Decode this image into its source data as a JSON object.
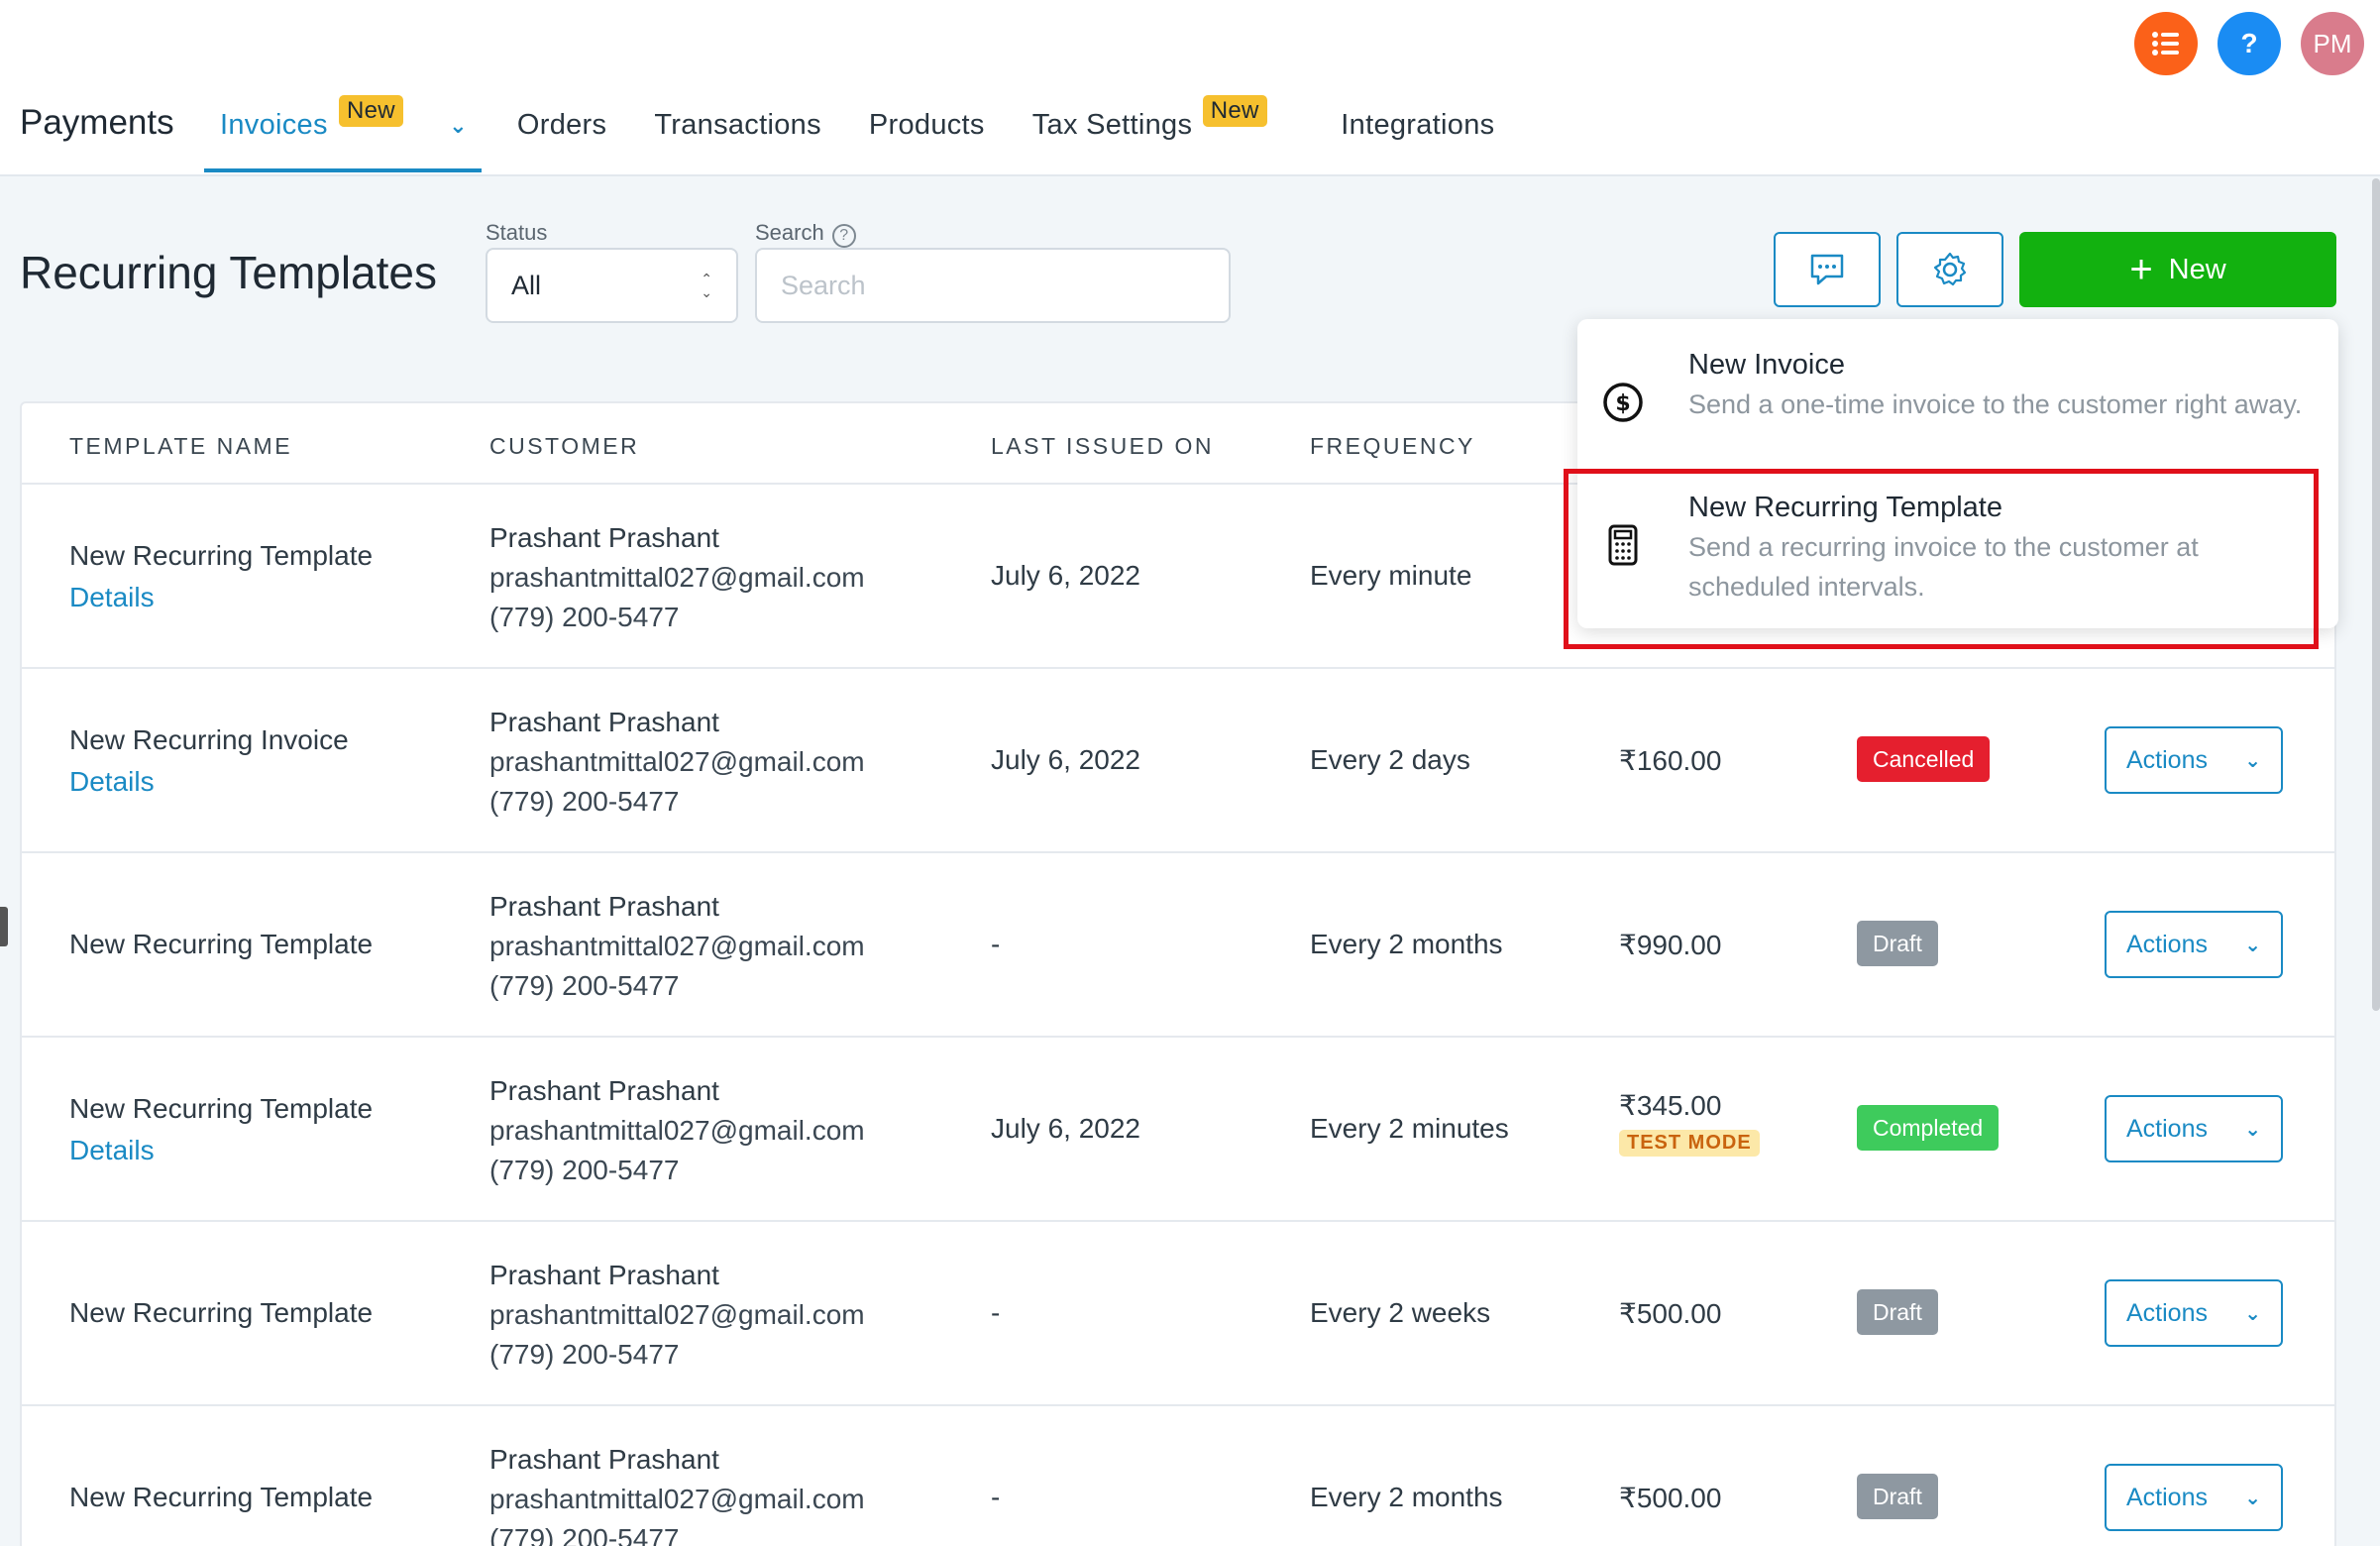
{
  "header": {
    "app_title": "Payments",
    "tabs": [
      {
        "label": "Invoices",
        "badge": "New",
        "active": true
      },
      {
        "label": "Orders"
      },
      {
        "label": "Transactions"
      },
      {
        "label": "Products"
      },
      {
        "label": "Tax Settings",
        "badge": "New"
      },
      {
        "label": "Integrations"
      }
    ],
    "icons": {
      "tasks": "list-icon",
      "help": "?",
      "avatar_initials": "PM"
    }
  },
  "page": {
    "title": "Recurring Templates",
    "status_label": "Status",
    "status_value": "All",
    "search_label": "Search",
    "search_placeholder": "Search",
    "new_button_label": "New"
  },
  "dropdown": {
    "items": [
      {
        "title": "New Invoice",
        "description": "Send a one-time invoice to the customer right away."
      },
      {
        "title": "New Recurring Template",
        "description": "Send a recurring invoice to the customer at scheduled intervals."
      }
    ]
  },
  "table": {
    "columns": [
      "TEMPLATE NAME",
      "CUSTOMER",
      "LAST ISSUED ON",
      "FREQUENCY"
    ],
    "rows": [
      {
        "name": "New Recurring Template",
        "details": "Details",
        "customer": "Prashant Prashant",
        "email": "prashantmittal027@gmail.com",
        "phone": "(779) 200-5477",
        "last_issued": "July 6, 2022",
        "frequency": "Every minute"
      },
      {
        "name": "New Recurring Invoice",
        "details": "Details",
        "customer": "Prashant Prashant",
        "email": "prashantmittal027@gmail.com",
        "phone": "(779) 200-5477",
        "last_issued": "July 6, 2022",
        "frequency": "Every 2 days",
        "amount": "₹160.00",
        "status": "Cancelled",
        "actions": "Actions"
      },
      {
        "name": "New Recurring Template",
        "customer": "Prashant Prashant",
        "email": "prashantmittal027@gmail.com",
        "phone": "(779) 200-5477",
        "last_issued": "-",
        "frequency": "Every 2 months",
        "amount": "₹990.00",
        "status": "Draft",
        "actions": "Actions"
      },
      {
        "name": "New Recurring Template",
        "details": "Details",
        "customer": "Prashant Prashant",
        "email": "prashantmittal027@gmail.com",
        "phone": "(779) 200-5477",
        "last_issued": "July 6, 2022",
        "frequency": "Every 2 minutes",
        "amount": "₹345.00",
        "amount_tag": "TEST MODE",
        "status": "Completed",
        "actions": "Actions"
      },
      {
        "name": "New Recurring Template",
        "customer": "Prashant Prashant",
        "email": "prashantmittal027@gmail.com",
        "phone": "(779) 200-5477",
        "last_issued": "-",
        "frequency": "Every 2 weeks",
        "amount": "₹500.00",
        "status": "Draft",
        "actions": "Actions"
      },
      {
        "name": "New Recurring Template",
        "customer": "Prashant Prashant",
        "email": "prashantmittal027@gmail.com",
        "phone": "(779) 200-5477",
        "last_issued": "-",
        "frequency": "Every 2 months",
        "amount": "₹500.00",
        "status": "Draft",
        "actions": "Actions"
      }
    ]
  },
  "colors": {
    "accent": "#1a8ac4",
    "new_button": "#12b10f",
    "highlight": "#e0101a"
  }
}
